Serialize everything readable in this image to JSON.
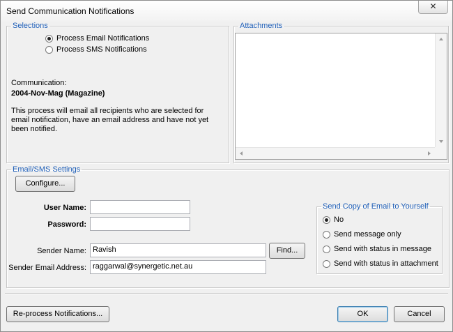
{
  "window": {
    "title": "Send Communication Notifications",
    "close_glyph": "✕"
  },
  "selections": {
    "legend": "Selections",
    "options": [
      {
        "label": "Process Email Notifications",
        "checked": true
      },
      {
        "label": "Process SMS Notifications",
        "checked": false
      }
    ],
    "communication_label": "Communication:",
    "communication_value": "2004-Nov-Mag (Magazine)",
    "description": "This process will email all recipients who are selected for email notification, have an email address and have not yet been notified."
  },
  "attachments": {
    "legend": "Attachments",
    "items": []
  },
  "settings": {
    "legend": "Email/SMS Settings",
    "configure_label": "Configure...",
    "user_name_label": "User Name:",
    "user_name_value": "",
    "password_label": "Password:",
    "password_value": "",
    "sender_name_label": "Sender Name:",
    "sender_name_value": "Ravish",
    "find_label": "Find...",
    "sender_email_label": "Sender Email Address:",
    "sender_email_value": "raggarwal@synergetic.net.au"
  },
  "copy_group": {
    "legend": "Send Copy of Email to Yourself",
    "options": [
      {
        "label": "No",
        "checked": true
      },
      {
        "label": "Send message only",
        "checked": false
      },
      {
        "label": "Send with status in message",
        "checked": false
      },
      {
        "label": "Send with status in attachment",
        "checked": false
      }
    ]
  },
  "footer": {
    "reprocess_label": "Re-process Notifications...",
    "ok_label": "OK",
    "cancel_label": "Cancel"
  },
  "colors": {
    "legend_text": "#1f5fb8",
    "window_bg": "#f0f0f0",
    "group_border": "#c7c7c7"
  }
}
